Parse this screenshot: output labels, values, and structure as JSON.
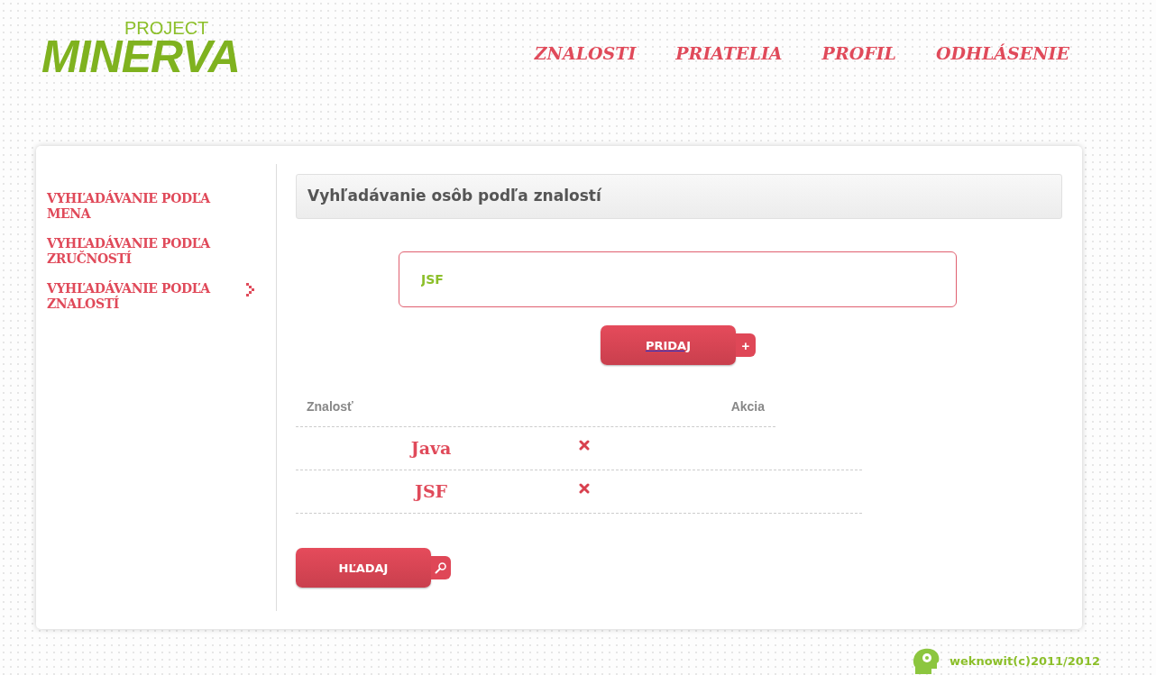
{
  "logo": {
    "small": "PROJECT",
    "large": "MINERVA"
  },
  "nav": [
    "ZNALOSTI",
    "PRIATELIA",
    "PROFIL",
    "ODHLÁSENIE"
  ],
  "sidebar": {
    "items": [
      {
        "label": "VYHĽADÁVANIE PODĽA MENA",
        "selected": false
      },
      {
        "label": "VYHĽADÁVANIE PODĽA ZRUČNOSTÍ",
        "selected": false
      },
      {
        "label": "VYHĽADÁVANIE PODĽA ZNALOSTÍ",
        "selected": true
      }
    ]
  },
  "panel_title": "Vyhľadávanie osôb podľa znalostí",
  "skill_input": {
    "value": "JSF"
  },
  "add_button": {
    "label": "PRIDAJ",
    "tab": "+"
  },
  "table": {
    "columns": [
      "Znalosť",
      "Akcia"
    ],
    "rows": [
      {
        "skill": "Java"
      },
      {
        "skill": "JSF"
      }
    ]
  },
  "search_button": {
    "label": "HĽADAJ"
  },
  "footer": "weknowit(c)2011/2012"
}
